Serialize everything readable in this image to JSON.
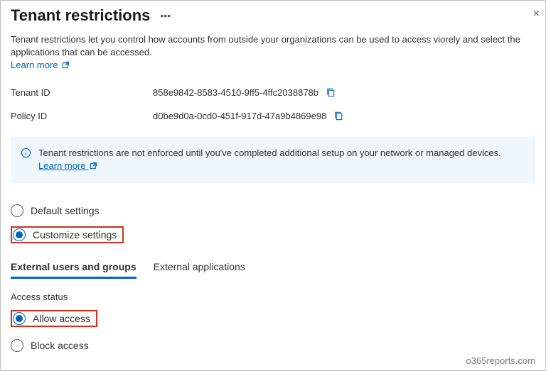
{
  "header": {
    "title": "Tenant restrictions"
  },
  "intro": {
    "text": "Tenant restrictions let you control how accounts from outside your organizations can be used to access viorely and select the applications that can be accessed.",
    "learn_more": "Learn more"
  },
  "fields": {
    "tenant_id_label": "Tenant ID",
    "tenant_id_value": "858e9842-8583-4510-9ff5-4ffc2038878b",
    "policy_id_label": "Policy ID",
    "policy_id_value": "d0be9d0a-0cd0-451f-917d-47a9b4869e98"
  },
  "info": {
    "text": "Tenant restrictions are not enforced until you've completed additional setup on your network or managed devices.",
    "learn_more": "Learn more"
  },
  "settings_mode": {
    "default": "Default settings",
    "customize": "Customize settings"
  },
  "tabs": {
    "users": "External users and groups",
    "apps": "External applications"
  },
  "access": {
    "section_label": "Access status",
    "allow": "Allow access",
    "block": "Block access"
  },
  "watermark": "o365reports.com"
}
